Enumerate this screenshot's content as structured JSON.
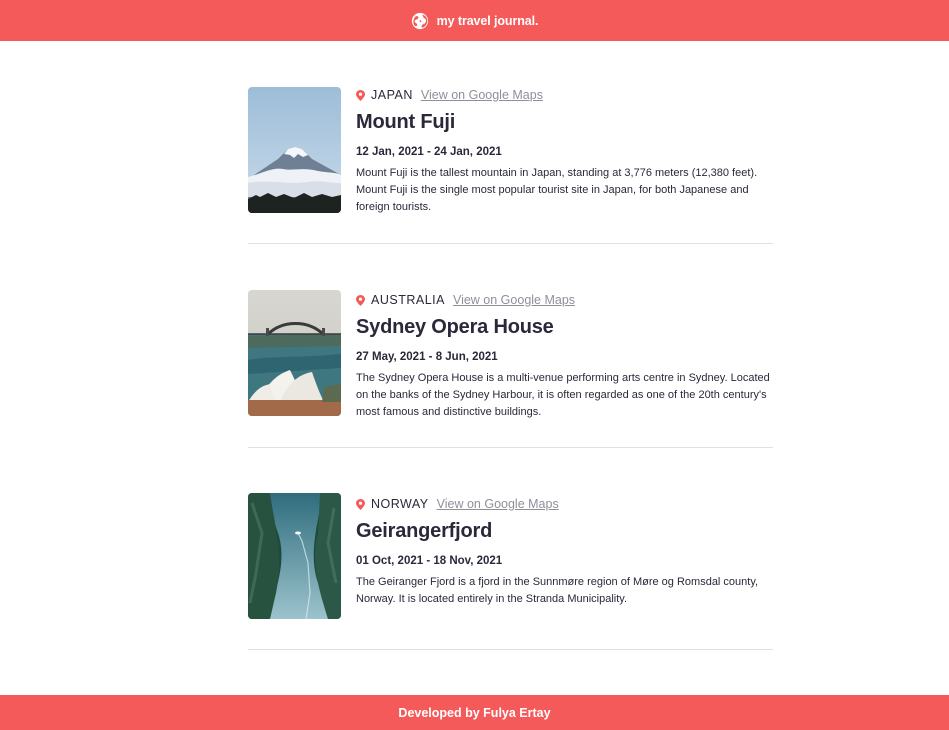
{
  "header": {
    "title": "my travel journal.",
    "icon": "globe-icon"
  },
  "colors": {
    "accent": "#f55a5a",
    "text": "#2b283a",
    "muted": "#918e9b",
    "divider": "#e0e0e0"
  },
  "entries": [
    {
      "country": "JAPAN",
      "maps_link": "View on Google Maps",
      "place": "Mount Fuji",
      "dates": "12 Jan, 2021 - 24 Jan, 2021",
      "description": "Mount Fuji is the tallest mountain in Japan, standing at 3,776 meters (12,380 feet). Mount Fuji is the single most popular tourist site in Japan, for both Japanese and foreign tourists."
    },
    {
      "country": "AUSTRALIA",
      "maps_link": "View on Google Maps",
      "place": "Sydney Opera House",
      "dates": "27 May, 2021 - 8 Jun, 2021",
      "description": "The Sydney Opera House is a multi-venue performing arts centre in Sydney. Located on the banks of the Sydney Harbour, it is often regarded as one of the 20th century's most famous and distinctive buildings."
    },
    {
      "country": "NORWAY",
      "maps_link": "View on Google Maps",
      "place": "Geirangerfjord",
      "dates": "01 Oct, 2021 - 18 Nov, 2021",
      "description": "The Geiranger Fjord is a fjord in the Sunnmøre region of Møre og Romsdal county, Norway. It is located entirely in the Stranda Municipality."
    }
  ],
  "footer": {
    "text": "Developed by Fulya Ertay"
  }
}
